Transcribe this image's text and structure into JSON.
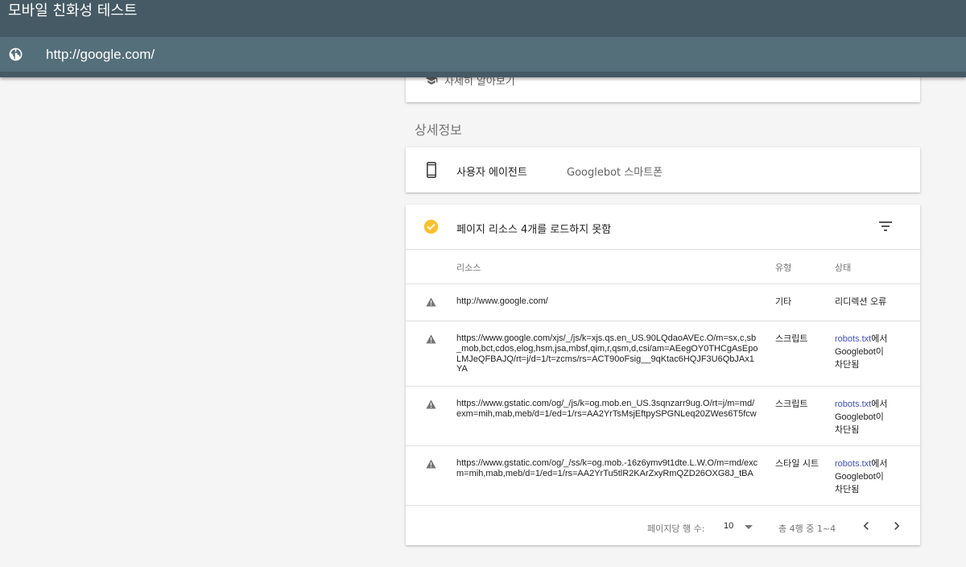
{
  "header": {
    "title": "모바일 친화성 테스트",
    "url": "http://google.com/",
    "globe_icon": "globe-icon"
  },
  "learn_more": {
    "label": "자세히 알아보기",
    "icon": "school-icon"
  },
  "details": {
    "heading": "상세정보",
    "user_agent_label": "사용자 에이전트",
    "user_agent_value": "Googlebot 스마트폰",
    "device_icon": "smartphone-icon"
  },
  "resources": {
    "title": "페이지 리소스 4개를 로드하지 못함",
    "columns": {
      "resource": "리소스",
      "type": "유형",
      "status": "상태"
    },
    "rows": [
      {
        "url": "http://www.google.com/",
        "type": "기타",
        "status": "리디렉션 오류"
      },
      {
        "url": "https://www.google.com/xjs/_/js/k=xjs.qs.en_US.90LQdaoAVEc.O/m=sx,c,sb_mob,bct,cdos,elog,hsm,jsa,mbsf,qim,r,qsm,d,csi/am=AEegOY0THCgAsEpoLMJeQFBAJQ/rt=j/d=1/t=zcms/rs=ACT90oFsig__9qKtac6HQJF3U6QbJAx1YA",
        "type": "스크립트",
        "status_link": "robots.txt",
        "status_rest_1": "에서",
        "status_bot": "Googlebot",
        "status_rest_2": "이 차단됨"
      },
      {
        "url": "https://www.gstatic.com/og/_/js/k=og.mob.en_US.3sqnzarr9ug.O/rt=j/m=md/exm=mih,mab,meb/d=1/ed=1/rs=AA2YrTsMsjEftpySPGNLeq20ZWes6T5fcw",
        "type": "스크립트",
        "status_link": "robots.txt",
        "status_rest_1": "에서",
        "status_bot": "Googlebot",
        "status_rest_2": "이 차단됨"
      },
      {
        "url": "https://www.gstatic.com/og/_/ss/k=og.mob.-16z6ymv9t1dte.L.W.O/m=md/excm=mih,mab,meb/d=1/ed=1/rs=AA2YrTu5tlR2KArZxyRmQZD26OXG8J_tBA",
        "type": "스타일 시트",
        "status_link": "robots.txt",
        "status_rest_1": "에서",
        "status_bot": "Googlebot",
        "status_rest_2": "이 차단됨"
      }
    ],
    "pagination": {
      "rows_per_page_label": "페이지당 행 수:",
      "rows_per_page_value": "10",
      "range": "총 4행 중 1~4"
    }
  },
  "colors": {
    "header_bg": "#455a64",
    "url_bar_bg": "#546e7a",
    "check_amber": "#fbc02d",
    "link_blue": "#3f51b5",
    "warning_grey": "#757575"
  }
}
